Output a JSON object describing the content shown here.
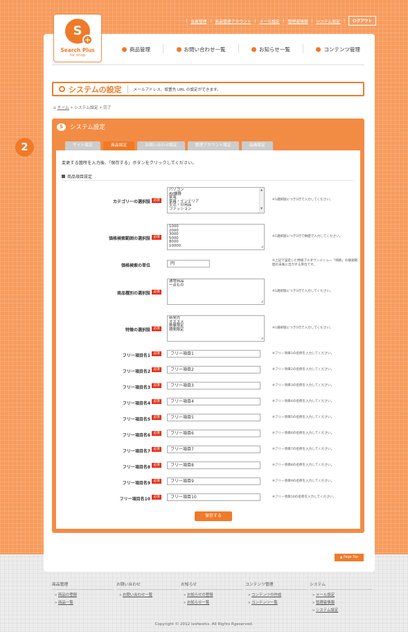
{
  "top_links": [
    "会員管理",
    "商品管理アカウント",
    "メール設定",
    "管理者情報",
    "システム設定"
  ],
  "logout": "ログアウト",
  "logo": {
    "line1": "Search Plus",
    "line2": "for shop"
  },
  "nav": [
    "商品管理",
    "お問い合わせ一覧",
    "お知らせ一覧",
    "コンテンツ管理"
  ],
  "page": {
    "title": "システムの設定",
    "desc": "メールアドレス、設置先 URL の設定ができます。"
  },
  "breadcrumb": {
    "home": "ホーム",
    "mid": "システム設定",
    "current": "完了"
  },
  "step": "2",
  "settings": {
    "header": "システム設定",
    "tabs": [
      "サイト設定",
      "商品設定",
      "お問い合わせ設定",
      "管理アカウント設定",
      "会員設定"
    ],
    "active_tab": 1,
    "instruction": "変更する箇所を入力後、「保存する」ボタンをクリックしてください。",
    "section": "商品項目設定",
    "required": "必須",
    "category": {
      "label": "カテゴリーの選択肢",
      "lines": [
        "パソコン",
        "AV機器",
        "家電",
        "家具・インテリア",
        "生活・日用品",
        "ファッション"
      ],
      "note": "※1選択肢につき1行で入力してください。"
    },
    "price_range": {
      "label": "価格検索範囲の選択肢",
      "lines": [
        "1000",
        "2000",
        "3000",
        "5000",
        "8000",
        "10000"
      ],
      "note": "※1選択肢につき1行で数値で入力してください。"
    },
    "price_unit": {
      "label": "価格検索の単位",
      "value": "円",
      "note": "※上記で設定した特検プルダウンメニュー「価格」の検索範囲の末尾に出力する単位です。"
    },
    "product_type": {
      "label": "商品種別の選択肢",
      "lines": [
        "通常商品",
        "一点もの"
      ],
      "note": "※1選択肢につき1行で入力してください。"
    },
    "features": {
      "label": "特徴の選択肢",
      "lines": [
        "新発売",
        "オススメ",
        "数量限定",
        "期間限定"
      ],
      "note": "※1選択肢につき1行で入力してください。"
    },
    "free_items": [
      {
        "label": "フリー項目名1",
        "value": "フリー項目1",
        "note": "※フリー項目1の名称を入力してください。"
      },
      {
        "label": "フリー項目名2",
        "value": "フリー項目2",
        "note": "※フリー項目2の名称を入力してください。"
      },
      {
        "label": "フリー項目名3",
        "value": "フリー項目3",
        "note": "※フリー項目3の名称を入力してください。"
      },
      {
        "label": "フリー項目名4",
        "value": "フリー項目4",
        "note": "※フリー項目4の名称を入力してください。"
      },
      {
        "label": "フリー項目名5",
        "value": "フリー項目5",
        "note": "※フリー項目5の名称を入力してください。"
      },
      {
        "label": "フリー項目名6",
        "value": "フリー項目6",
        "note": "※フリー項目6の名称を入力してください。"
      },
      {
        "label": "フリー項目名7",
        "value": "フリー項目7",
        "note": "※フリー項目7の名称を入力してください。"
      },
      {
        "label": "フリー項目名8",
        "value": "フリー項目8",
        "note": "※フリー項目8の名称を入力してください。"
      },
      {
        "label": "フリー項目名9",
        "value": "フリー項目9",
        "note": "※フリー項目9の名称を入力してください。"
      },
      {
        "label": "フリー項目名10",
        "value": "フリー項目10",
        "note": "※フリー項目10の名称を入力してください。"
      }
    ],
    "save": "保存する"
  },
  "page_top": "Page Top",
  "footer": [
    {
      "head": "商品管理",
      "links": [
        "商品の登録",
        "商品一覧"
      ]
    },
    {
      "head": "お問い合わせ",
      "links": [
        "お問い合わせ一覧"
      ]
    },
    {
      "head": "お知らせ",
      "links": [
        "お知らせの登録",
        "お知らせ一覧"
      ]
    },
    {
      "head": "コンテンツ管理",
      "links": [
        "コンテンツの作成",
        "コンテンツ一覧"
      ]
    },
    {
      "head": "システム",
      "links": [
        "メール設定",
        "管理者情報",
        "システム設定"
      ]
    }
  ],
  "copyright": "Copyright © 2012 lesfworks. All Rights Rgeserved."
}
